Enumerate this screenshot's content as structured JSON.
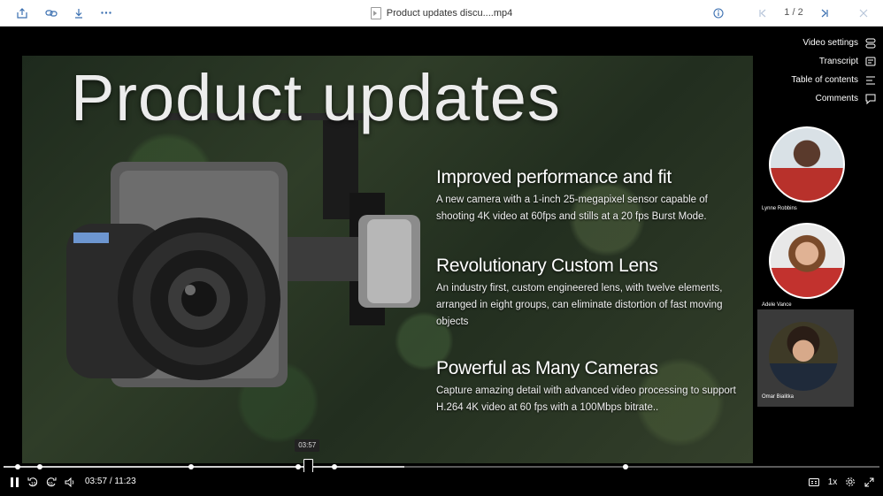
{
  "toolbar": {
    "file_title": "Product updates discu....mp4",
    "page": "1 / 2",
    "icons": [
      "share-icon",
      "link-icon",
      "download-icon",
      "more-icon",
      "info-icon",
      "prev-icon",
      "next-icon",
      "close-icon"
    ]
  },
  "slide": {
    "title": "Product updates",
    "bullets": [
      {
        "heading": "Improved performance and fit",
        "text": "A new camera with a 1-inch 25-megapixel sensor capable of shooting 4K video at 60fps and stills at a 20 fps Burst Mode."
      },
      {
        "heading": "Revolutionary Custom Lens",
        "text": "An industry first, custom engineered lens, with twelve elements, arranged in eight groups, can eliminate distortion of fast moving objects"
      },
      {
        "heading": "Powerful as Many Cameras",
        "text": "Capture amazing detail with advanced video processing to support H.264 4K video at 60 fps with a 100Mbps bitrate.."
      }
    ]
  },
  "menu": {
    "video_settings": "Video settings",
    "transcript": "Transcript",
    "toc": "Table of contents",
    "comments": "Comments"
  },
  "participants": [
    {
      "name": "Lynne Robbins"
    },
    {
      "name": "Adele Vance"
    },
    {
      "name": "Omar Bialitka"
    }
  ],
  "player": {
    "current_time": "03:57",
    "duration": "11:23",
    "time_sep": "/",
    "speed": "1x",
    "tooltip": "03:57",
    "progress_fraction": 0.3477
  },
  "colors": {
    "accent": "#3a6fb0",
    "background": "#000000"
  }
}
